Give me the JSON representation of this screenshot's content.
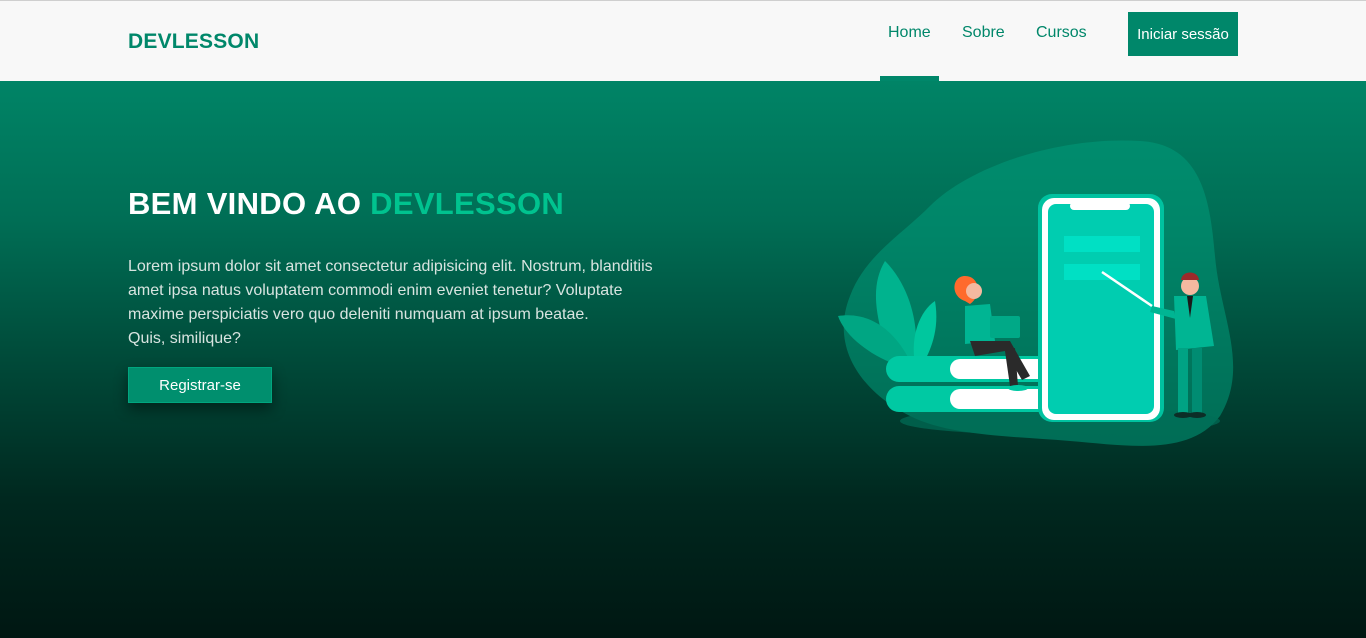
{
  "navbar": {
    "logo": "DEVLESSON",
    "links": [
      {
        "label": "Home",
        "active": true
      },
      {
        "label": "Sobre",
        "active": false
      },
      {
        "label": "Cursos",
        "active": false
      }
    ],
    "login_label": "Iniciar sessão"
  },
  "hero": {
    "title_prefix": "BEM VINDO AO ",
    "title_accent": "DEVLESSON",
    "text_lines": [
      "Lorem ipsum dolor sit amet consectetur adipisicing elit. Nostrum, blanditiis",
      "amet ipsa natus voluptatem commodi enim eveniet tenetur? Voluptate",
      "maxime perspiciatis vero quo deleniti numquam at ipsum beatae.",
      "Quis, similique?"
    ],
    "register_label": "Registrar-se"
  },
  "illustration": {
    "name": "online-learning-illustration",
    "elements": [
      "smartphone",
      "books-stack",
      "student-with-laptop",
      "teacher-with-pointer",
      "plant-leaves"
    ]
  },
  "colors": {
    "brand": "#00876a",
    "accent": "#00c38f",
    "hero_top": "#008466",
    "hero_bottom": "#001712"
  }
}
